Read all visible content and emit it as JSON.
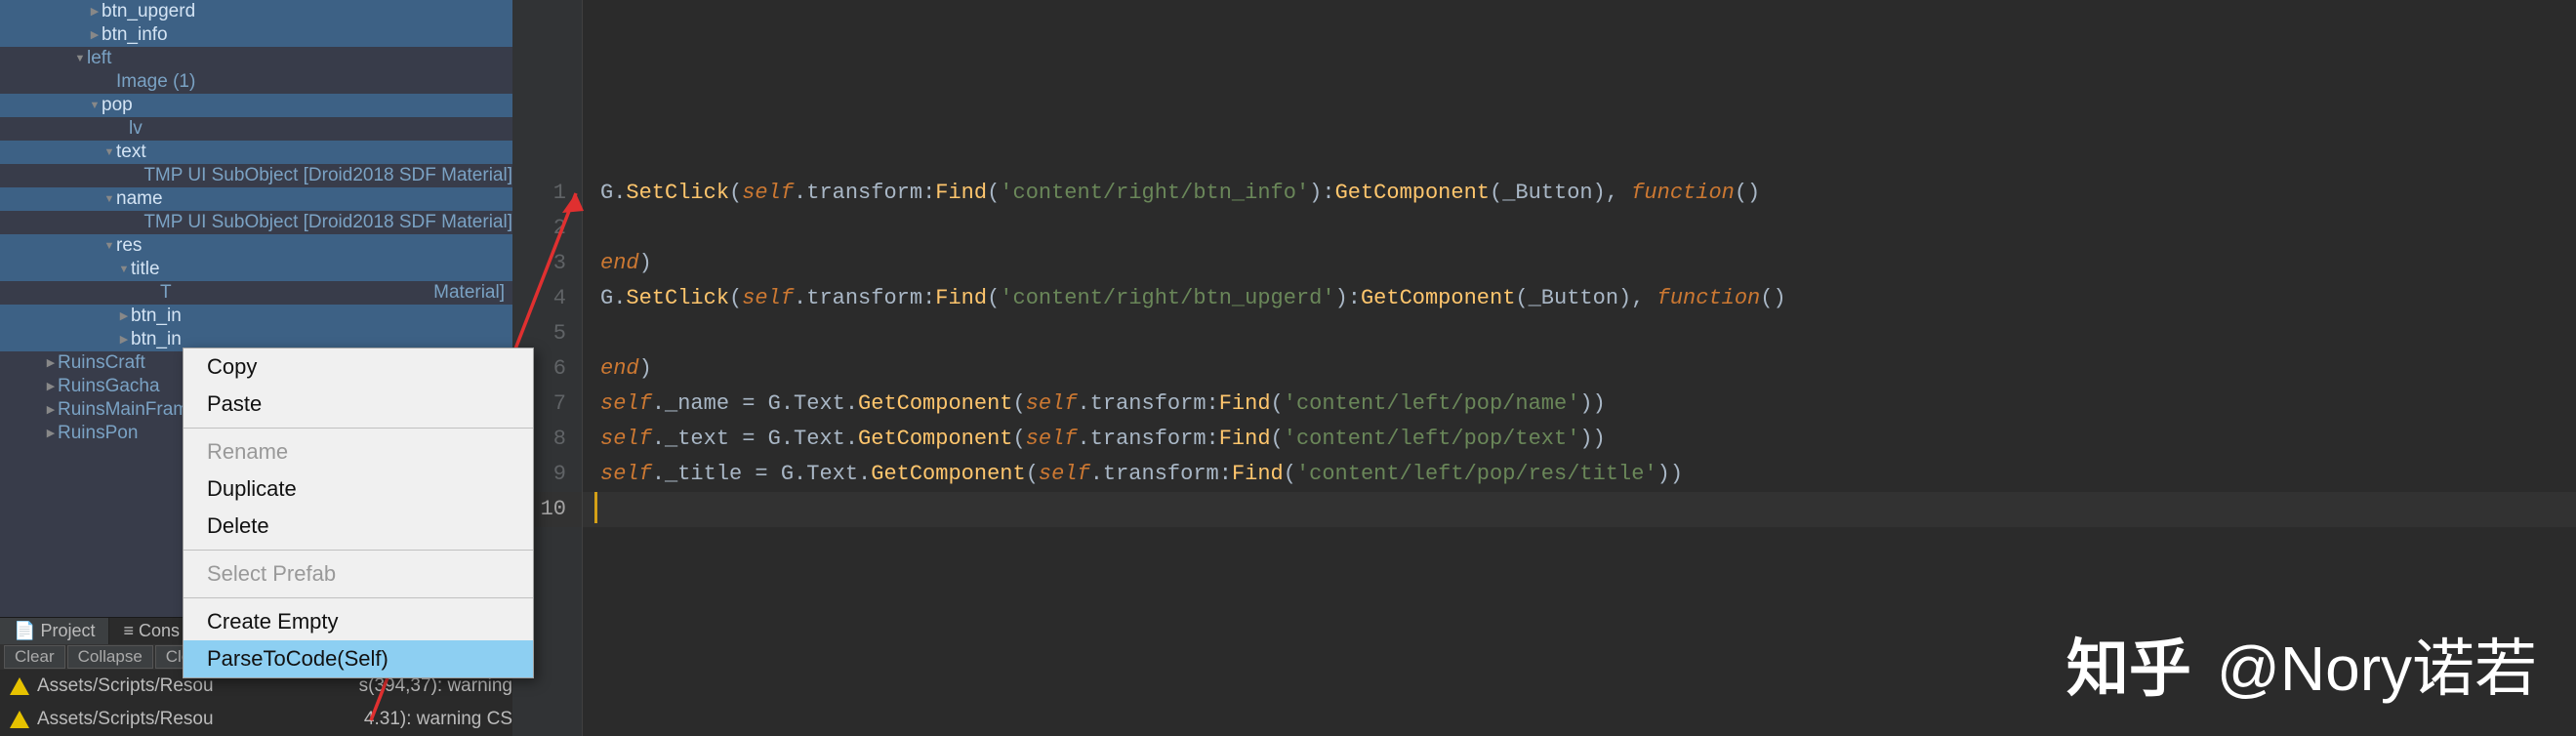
{
  "hierarchy": {
    "items": [
      {
        "indent": 90,
        "arrow": "▶",
        "label": "btn_upgerd",
        "selected": true
      },
      {
        "indent": 90,
        "arrow": "▶",
        "label": "btn_info",
        "selected": true
      },
      {
        "indent": 75,
        "arrow": "▼",
        "label": "left",
        "selected": false
      },
      {
        "indent": 105,
        "arrow": "",
        "label": "Image (1)",
        "selected": false
      },
      {
        "indent": 90,
        "arrow": "▼",
        "label": "pop",
        "selected": true
      },
      {
        "indent": 118,
        "arrow": "",
        "label": "lv",
        "selected": false
      },
      {
        "indent": 105,
        "arrow": "▼",
        "label": "text",
        "selected": true
      },
      {
        "indent": 135,
        "arrow": "",
        "label": "TMP UI SubObject [Droid2018 SDF Material]",
        "selected": false
      },
      {
        "indent": 105,
        "arrow": "▼",
        "label": "name",
        "selected": true
      },
      {
        "indent": 135,
        "arrow": "",
        "label": "TMP UI SubObject [Droid2018 SDF Material]",
        "selected": false
      },
      {
        "indent": 105,
        "arrow": "▼",
        "label": "res",
        "selected": true
      },
      {
        "indent": 120,
        "arrow": "▼",
        "label": "title",
        "selected": true
      },
      {
        "indent": 150,
        "arrow": "",
        "label": "T",
        "selected": false,
        "truncRight": "Material]"
      },
      {
        "indent": 120,
        "arrow": "▶",
        "label": "btn_in",
        "selected": true
      },
      {
        "indent": 120,
        "arrow": "▶",
        "label": "btn_in",
        "selected": true
      },
      {
        "indent": 45,
        "arrow": "▶",
        "label": "RuinsCraft",
        "selected": false
      },
      {
        "indent": 45,
        "arrow": "▶",
        "label": "RuinsGacha",
        "selected": false
      },
      {
        "indent": 45,
        "arrow": "▶",
        "label": "RuinsMainFram",
        "selected": false
      },
      {
        "indent": 45,
        "arrow": "▶",
        "label": "RuinsPon",
        "selected": false
      }
    ]
  },
  "tabs": {
    "project": "Project",
    "console": "Cons"
  },
  "toolbar": {
    "clear": "Clear",
    "collapse": "Collapse",
    "clear_on": "Clear on"
  },
  "context_menu": {
    "copy": "Copy",
    "paste": "Paste",
    "rename": "Rename",
    "duplicate": "Duplicate",
    "delete": "Delete",
    "select_prefab": "Select Prefab",
    "create_empty": "Create Empty",
    "parse_to_code": "ParseToCode(Self)"
  },
  "console": {
    "row1": {
      "path": "Assets/Scripts/Resou",
      "tail": "s(394,37): warning"
    },
    "row2": {
      "path": "Assets/Scripts/Resou",
      "tail": "4.31): warning CS"
    }
  },
  "code": {
    "lines": [
      {
        "n": 1,
        "segments": [
          {
            "t": "G",
            "c": "ident"
          },
          {
            "t": ".",
            "c": "ident"
          },
          {
            "t": "SetClick",
            "c": "fn"
          },
          {
            "t": "(",
            "c": "ident"
          },
          {
            "t": "self",
            "c": "kw-self"
          },
          {
            "t": ".transform:",
            "c": "ident"
          },
          {
            "t": "Find",
            "c": "fn"
          },
          {
            "t": "(",
            "c": "ident"
          },
          {
            "t": "'content/right/btn_info'",
            "c": "str"
          },
          {
            "t": "):",
            "c": "ident"
          },
          {
            "t": "GetComponent",
            "c": "fn"
          },
          {
            "t": "(_Button), ",
            "c": "ident"
          },
          {
            "t": "function",
            "c": "kw-self"
          },
          {
            "t": "()",
            "c": "ident"
          }
        ]
      },
      {
        "n": 2,
        "segments": []
      },
      {
        "n": 3,
        "segments": [
          {
            "t": "end",
            "c": "kw-self"
          },
          {
            "t": ")",
            "c": "ident"
          }
        ]
      },
      {
        "n": 4,
        "segments": [
          {
            "t": "G",
            "c": "ident"
          },
          {
            "t": ".",
            "c": "ident"
          },
          {
            "t": "SetClick",
            "c": "fn"
          },
          {
            "t": "(",
            "c": "ident"
          },
          {
            "t": "self",
            "c": "kw-self"
          },
          {
            "t": ".transform:",
            "c": "ident"
          },
          {
            "t": "Find",
            "c": "fn"
          },
          {
            "t": "(",
            "c": "ident"
          },
          {
            "t": "'content/right/btn_upgerd'",
            "c": "str"
          },
          {
            "t": "):",
            "c": "ident"
          },
          {
            "t": "GetComponent",
            "c": "fn"
          },
          {
            "t": "(_Button), ",
            "c": "ident"
          },
          {
            "t": "function",
            "c": "kw-self"
          },
          {
            "t": "()",
            "c": "ident"
          }
        ]
      },
      {
        "n": 5,
        "segments": []
      },
      {
        "n": 6,
        "segments": [
          {
            "t": "end",
            "c": "kw-self"
          },
          {
            "t": ")",
            "c": "ident"
          }
        ]
      },
      {
        "n": 7,
        "segments": [
          {
            "t": "self",
            "c": "kw-self"
          },
          {
            "t": "._name = G.Text.",
            "c": "ident"
          },
          {
            "t": "GetComponent",
            "c": "fn"
          },
          {
            "t": "(",
            "c": "ident"
          },
          {
            "t": "self",
            "c": "kw-self"
          },
          {
            "t": ".transform:",
            "c": "ident"
          },
          {
            "t": "Find",
            "c": "fn"
          },
          {
            "t": "(",
            "c": "ident"
          },
          {
            "t": "'content/left/pop/name'",
            "c": "str"
          },
          {
            "t": "))",
            "c": "ident"
          }
        ]
      },
      {
        "n": 8,
        "segments": [
          {
            "t": "self",
            "c": "kw-self"
          },
          {
            "t": "._text = G.Text.",
            "c": "ident"
          },
          {
            "t": "GetComponent",
            "c": "fn"
          },
          {
            "t": "(",
            "c": "ident"
          },
          {
            "t": "self",
            "c": "kw-self"
          },
          {
            "t": ".transform:",
            "c": "ident"
          },
          {
            "t": "Find",
            "c": "fn"
          },
          {
            "t": "(",
            "c": "ident"
          },
          {
            "t": "'content/left/pop/text'",
            "c": "str"
          },
          {
            "t": "))",
            "c": "ident"
          }
        ]
      },
      {
        "n": 9,
        "segments": [
          {
            "t": "self",
            "c": "kw-self"
          },
          {
            "t": "._title = G.Text.",
            "c": "ident"
          },
          {
            "t": "GetComponent",
            "c": "fn"
          },
          {
            "t": "(",
            "c": "ident"
          },
          {
            "t": "self",
            "c": "kw-self"
          },
          {
            "t": ".transform:",
            "c": "ident"
          },
          {
            "t": "Find",
            "c": "fn"
          },
          {
            "t": "(",
            "c": "ident"
          },
          {
            "t": "'content/left/pop/res/title'",
            "c": "str"
          },
          {
            "t": "))",
            "c": "ident"
          }
        ]
      },
      {
        "n": 10,
        "segments": [],
        "current": true
      }
    ]
  },
  "watermark": {
    "site": "知乎",
    "author": "@Nory诺若"
  }
}
